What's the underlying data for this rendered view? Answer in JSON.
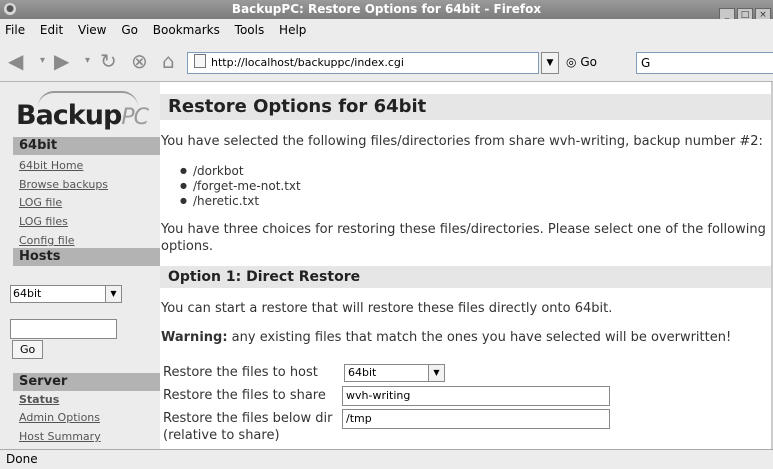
{
  "window": {
    "title": "BackupPC: Restore Options for 64bit - Firefox"
  },
  "menu": [
    "File",
    "Edit",
    "View",
    "Go",
    "Bookmarks",
    "Tools",
    "Help"
  ],
  "nav": {
    "url": "http://localhost/backuppc/index.cgi",
    "go_label": "Go",
    "search_value": "G"
  },
  "logo": {
    "text": "Backup",
    "suffix": "PC"
  },
  "sidebar": {
    "host_heading": "64bit",
    "host_links": [
      "64bit Home",
      "Browse backups",
      "LOG file",
      "LOG files",
      "Config file"
    ],
    "hosts_heading": "Hosts",
    "host_select": "64bit",
    "go_button": "Go",
    "server_heading": "Server",
    "server_links": [
      "Status",
      "Admin Options",
      "Host Summary"
    ]
  },
  "main": {
    "title": "Restore Options for 64bit",
    "intro": "You have selected the following files/directories from share wvh-writing, backup number #2:",
    "files": [
      "/dorkbot",
      "/forget-me-not.txt",
      "/heretic.txt"
    ],
    "choices_line1": "You have three choices for restoring these files/directories. Please select one of the following",
    "choices_line2": "options.",
    "option1_title": "Option 1: Direct Restore",
    "option1_desc": "You can start a restore that will restore these files directly onto 64bit.",
    "warning_label": "Warning:",
    "warning_text": " any existing files that match the ones you have selected will be overwritten!",
    "form": {
      "host_label": "Restore the files to host",
      "host_value": "64bit",
      "share_label": "Restore the files to share",
      "share_value": "wvh-writing",
      "dir_label": "Restore the files below dir",
      "dir_sublabel": "(relative to share)",
      "dir_value": "/tmp"
    }
  },
  "status": {
    "text": "Done"
  }
}
